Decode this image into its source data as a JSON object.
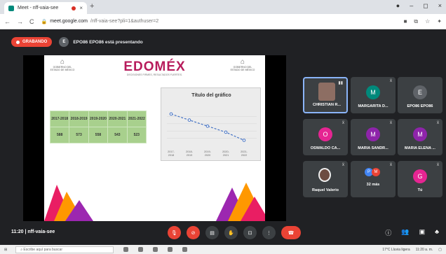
{
  "browser": {
    "tab_title": "Meet - nff-vaia-see",
    "tab_close": "×",
    "new_tab": "+",
    "url_host": "meet.google.com",
    "url_path": "/nff-vaia-see?pli=1&authuser=2",
    "window_controls": [
      "●",
      "–",
      "◻",
      "×"
    ]
  },
  "meet": {
    "recording_label": "GRABANDO",
    "presenter_initial": "E",
    "presenting_text": "EPO86 EPO86 está presentando",
    "meeting_time": "11:20",
    "meeting_code": "nff-vaia-see"
  },
  "slide": {
    "logo_text": "EDOMÉX",
    "logo_tagline": "DECISIONES FIRMES, RESULTADOS FUERTES.",
    "crest_left": "GOBIERNO DEL ESTADO DE MÉXICO",
    "crest_right": "GOBIERNO DEL ESTADO DE MÉXICO",
    "table": {
      "headers": [
        "2017-2018",
        "2018-2019",
        "2019-2020",
        "2020-2021",
        "2021-2022"
      ],
      "values": [
        "588",
        "573",
        "558",
        "543",
        "523"
      ]
    }
  },
  "chart_data": {
    "type": "line",
    "title": "Título del gráfico",
    "categories": [
      "2017-2018",
      "2018-2019",
      "2019-2020",
      "2020-2021",
      "2021-2022"
    ],
    "values": [
      588,
      573,
      558,
      543,
      523
    ],
    "color": "#4472c4"
  },
  "participants": [
    {
      "name": "CHRISTIAN R...",
      "initial": "",
      "color": "#8d6e63",
      "active": true
    },
    {
      "name": "MARGARITA D...",
      "initial": "M",
      "color": "#00897b"
    },
    {
      "name": "EPO86 EPO86",
      "initial": "E",
      "color": "#5f6368"
    },
    {
      "name": "OSWALDO CA...",
      "initial": "O",
      "color": "#e52592"
    },
    {
      "name": "MARIA SANDR...",
      "initial": "M",
      "color": "#8e24aa"
    },
    {
      "name": "MARIA ELENA ...",
      "initial": "M",
      "color": "#8e24aa"
    },
    {
      "name": "Raquel Valerio",
      "initial": "",
      "color": "#6d4c41"
    },
    {
      "name": "32 más",
      "initial": "",
      "color": "#4285f4"
    },
    {
      "name": "Tú",
      "initial": "G",
      "color": "#e52592"
    }
  ],
  "taskbar": {
    "search_placeholder": "Escribe aquí para buscar",
    "weather": "17°C Lluvia ligera",
    "time": "11:20 a. m."
  }
}
